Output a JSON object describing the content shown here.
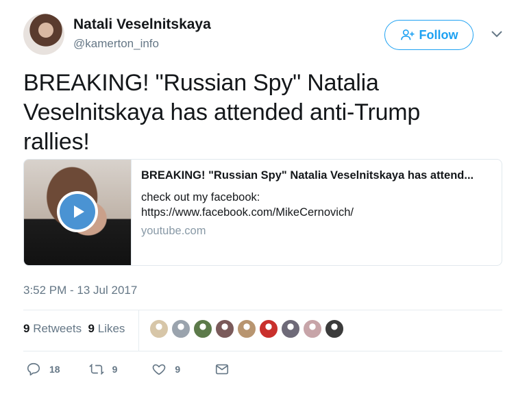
{
  "author": {
    "name": "Natali Veselnitskaya",
    "handle": "@kamerton_info"
  },
  "follow_button": {
    "label": "Follow"
  },
  "tweet": {
    "text": "BREAKING! \"Russian Spy\" Natalia Veselnitskaya has attended anti-Trump rallies!",
    "timestamp": "3:52 PM - 13 Jul 2017"
  },
  "card": {
    "title": "BREAKING! \"Russian Spy\" Natalia Veselnitskaya has attend...",
    "description_line1": "check out my facebook:",
    "description_line2": "https://www.facebook.com/MikeCernovich/",
    "domain": "youtube.com"
  },
  "stats": {
    "retweets_count": "9",
    "retweets_label": "Retweets",
    "likes_count": "9",
    "likes_label": "Likes"
  },
  "likers": [
    {
      "icon": "gavel",
      "color": "#d7c6a8"
    },
    {
      "icon": "photo",
      "color": "#9aa3ad"
    },
    {
      "icon": "photo",
      "color": "#5c7a4a"
    },
    {
      "icon": "photo",
      "color": "#7a5a5a"
    },
    {
      "icon": "photo",
      "color": "#b89570"
    },
    {
      "icon": "photo",
      "color": "#c9302c"
    },
    {
      "icon": "photo",
      "color": "#6e6a78"
    },
    {
      "icon": "photo",
      "color": "#c7a4a8"
    },
    {
      "icon": "photo",
      "color": "#3b3b3b"
    }
  ],
  "actions": {
    "reply_count": "18",
    "retweet_count": "9",
    "like_count": "9"
  },
  "colors": {
    "accent": "#1da1f2",
    "secondary_text": "#657786",
    "play_button": "#4a93d3"
  }
}
